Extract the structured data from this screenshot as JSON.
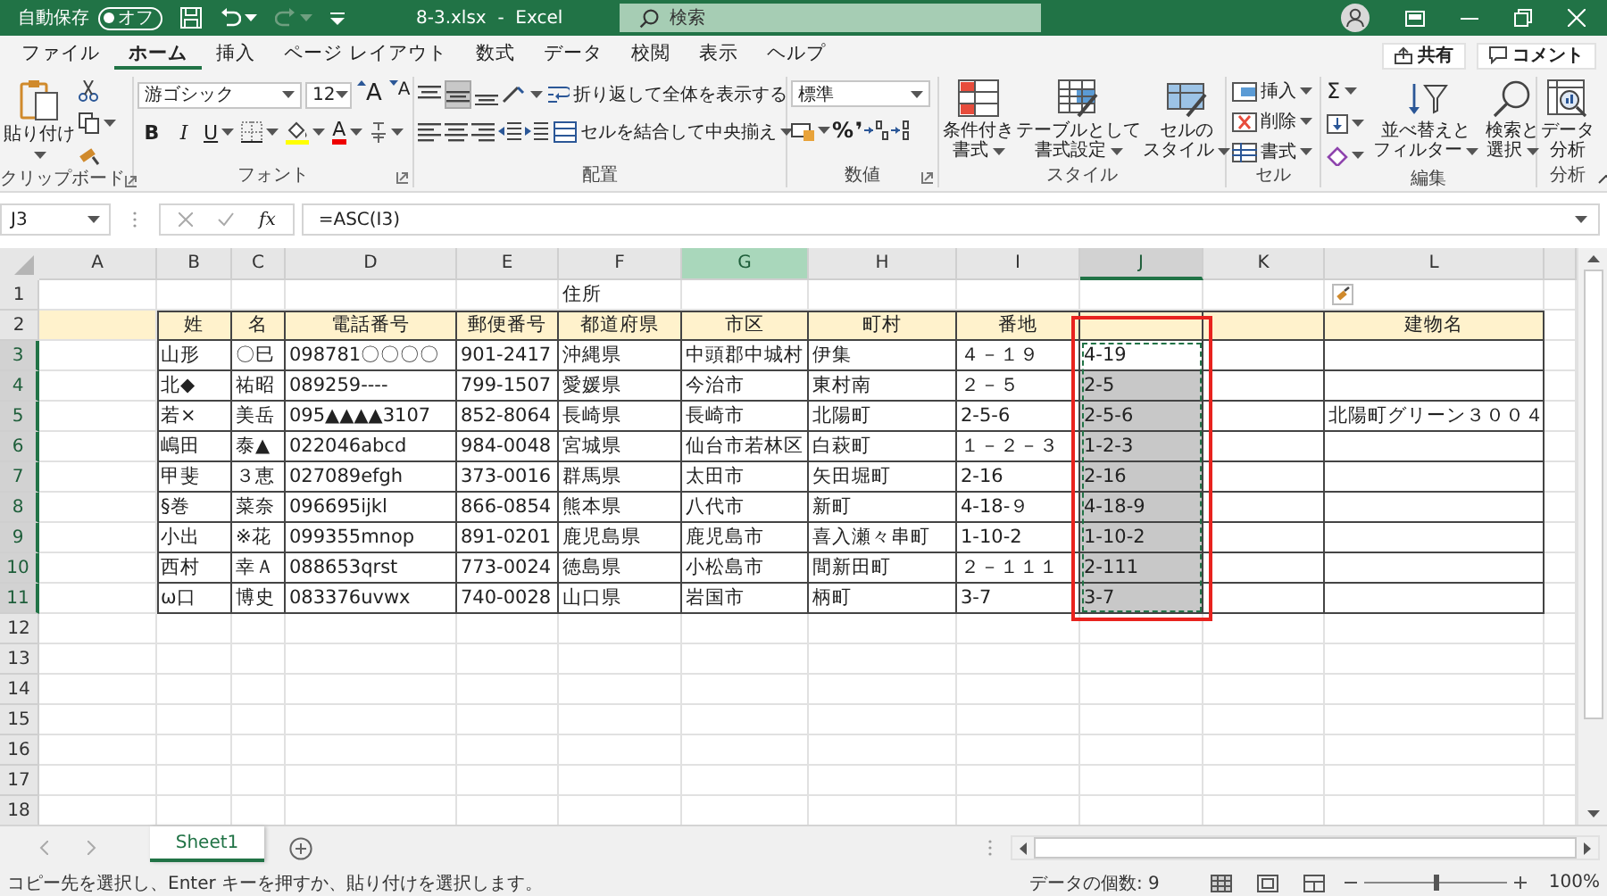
{
  "titlebar": {
    "autosave_label": "自動保存",
    "autosave_toggle": "オフ",
    "autosave_on": false,
    "title": "8-3.xlsx  -  Excel",
    "search_placeholder": "検索"
  },
  "ribbon_tabs": [
    {
      "label": "ファイル",
      "selected": false
    },
    {
      "label": "ホーム",
      "selected": true
    },
    {
      "label": "挿入",
      "selected": false
    },
    {
      "label": "ページ レイアウト",
      "selected": false
    },
    {
      "label": "数式",
      "selected": false
    },
    {
      "label": "データ",
      "selected": false
    },
    {
      "label": "校閲",
      "selected": false
    },
    {
      "label": "表示",
      "selected": false
    },
    {
      "label": "ヘルプ",
      "selected": false
    }
  ],
  "share": "共有",
  "comment": "コメント",
  "ribbon_groups": [
    {
      "kind": "clipboard",
      "label": "クリップボード",
      "launcher": true,
      "paste": "貼り付け"
    },
    {
      "kind": "font",
      "label": "フォント",
      "launcher": true,
      "font": "游ゴシック",
      "size": "12",
      "grow": "A",
      "shrink": "A",
      "bold": "B",
      "italic": "I",
      "underline": "U",
      "font_color": "A"
    },
    {
      "kind": "alignment",
      "label": "配置",
      "launcher": false,
      "vertical_align": [
        {
          "selected": false
        },
        {
          "selected": true
        },
        {
          "selected": false
        }
      ],
      "wrap": "折り返して全体を表示する",
      "merge": "セルを結合して中央揃え"
    },
    {
      "kind": "number",
      "label": "数値",
      "launcher": true,
      "format": "標準",
      "percent": "%",
      "comma": "❜"
    },
    {
      "kind": "styles",
      "label": "スタイル",
      "launcher": false,
      "buttons": [
        [
          "条件付き",
          "書式"
        ],
        [
          "テーブルとして",
          "書式設定"
        ],
        [
          "セルの",
          "スタイル"
        ]
      ]
    },
    {
      "kind": "cells",
      "label": "セル",
      "launcher": false,
      "buttons": [
        "挿入",
        "削除",
        "書式"
      ]
    },
    {
      "kind": "editing",
      "label": "編集",
      "launcher": false,
      "sum": "Σ",
      "buttons": [
        [
          "並べ替えと",
          "フィルター"
        ],
        [
          "検索と",
          "選択"
        ]
      ]
    },
    {
      "kind": "analysis",
      "label": "分析",
      "launcher": false,
      "buttons": [
        [
          "データ",
          "分析"
        ]
      ]
    }
  ],
  "formula_bar": {
    "name_box": "J3",
    "fx": "fx",
    "formula": "=ASC(I3)"
  },
  "columns": [
    {
      "label": "A",
      "selected": false,
      "highlighted": false
    },
    {
      "label": "B",
      "selected": false,
      "highlighted": false
    },
    {
      "label": "C",
      "selected": false,
      "highlighted": false
    },
    {
      "label": "D",
      "selected": false,
      "highlighted": false
    },
    {
      "label": "E",
      "selected": false,
      "highlighted": false
    },
    {
      "label": "F",
      "selected": false,
      "highlighted": false
    },
    {
      "label": "G",
      "selected": false,
      "highlighted": true
    },
    {
      "label": "H",
      "selected": false,
      "highlighted": false
    },
    {
      "label": "I",
      "selected": false,
      "highlighted": false
    },
    {
      "label": "J",
      "selected": true,
      "highlighted": false,
      "active": true,
      "copied": true,
      "framed": true
    },
    {
      "label": "K",
      "selected": false,
      "highlighted": false
    },
    {
      "label": "L",
      "selected": false,
      "highlighted": false,
      "paste_options": true
    }
  ],
  "rows": [
    {
      "header": "1",
      "kind": "plain",
      "selected": false,
      "cells": [
        null,
        null,
        null,
        null,
        null,
        "住所"
      ]
    },
    {
      "header": "2",
      "kind": "header",
      "selected": false,
      "cells": [
        null,
        "姓",
        "名",
        "電話番号",
        "郵便番号",
        "都道府県",
        "市区",
        "町村",
        "番地",
        null,
        null,
        "建物名"
      ]
    },
    {
      "header": "3",
      "kind": "data",
      "selected": true,
      "active": true,
      "cells": [
        null,
        "山形",
        "〇巳",
        "098781〇〇〇〇",
        "901-2417",
        "沖縄県",
        "中頭郡中城村",
        "伊集",
        "４－１９",
        "4-19"
      ]
    },
    {
      "header": "4",
      "kind": "data",
      "selected": true,
      "cells": [
        null,
        "北◆",
        "祐昭",
        "089259----",
        "799-1507",
        "愛媛県",
        "今治市",
        "東村南",
        "２－５",
        "2-5"
      ]
    },
    {
      "header": "5",
      "kind": "data",
      "selected": true,
      "cells": [
        null,
        "若×",
        "美岳",
        "095▲▲▲▲3107",
        "852-8064",
        "長崎県",
        "長崎市",
        "北陽町",
        "2-5-6",
        "2-5-6",
        null,
        "北陽町グリーン３００４"
      ]
    },
    {
      "header": "6",
      "kind": "data",
      "selected": true,
      "cells": [
        null,
        "嶋田",
        "泰▲",
        "022046abcd",
        "984-0048",
        "宮城県",
        "仙台市若林区",
        "白萩町",
        "１－２－３",
        "1-2-3"
      ]
    },
    {
      "header": "7",
      "kind": "data",
      "selected": true,
      "cells": [
        null,
        "甲斐",
        "３恵",
        "027089efgh",
        "373-0016",
        "群馬県",
        "太田市",
        "矢田堀町",
        "2-16",
        "2-16"
      ]
    },
    {
      "header": "8",
      "kind": "data",
      "selected": true,
      "cells": [
        null,
        "§巻",
        "菜奈",
        "096695ijkl",
        "866-0854",
        "熊本県",
        "八代市",
        "新町",
        "4-18-９",
        "4-18-9"
      ]
    },
    {
      "header": "9",
      "kind": "data",
      "selected": true,
      "cells": [
        null,
        "小出",
        "※花",
        "099355mnop",
        "891-0201",
        "鹿児島県",
        "鹿児島市",
        "喜入瀬々串町",
        "1-10-2",
        "1-10-2"
      ]
    },
    {
      "header": "10",
      "kind": "data",
      "selected": true,
      "cells": [
        null,
        "西村",
        "幸Ａ",
        "088653qrst",
        "773-0024",
        "徳島県",
        "小松島市",
        "間新田町",
        "２－１１１",
        "2-111"
      ]
    },
    {
      "header": "11",
      "kind": "data",
      "selected": true,
      "cells": [
        null,
        "ω口",
        "博史",
        "083376uvwx",
        "740-0028",
        "山口県",
        "岩国市",
        "柄町",
        "3-7",
        "3-7"
      ]
    },
    {
      "header": "12",
      "kind": "plain",
      "selected": false
    },
    {
      "header": "13",
      "kind": "plain",
      "selected": false
    },
    {
      "header": "14",
      "kind": "plain",
      "selected": false
    },
    {
      "header": "15",
      "kind": "plain",
      "selected": false
    },
    {
      "header": "16",
      "kind": "plain",
      "selected": false
    },
    {
      "header": "17",
      "kind": "plain",
      "selected": false
    },
    {
      "header": "18",
      "kind": "plain",
      "selected": false
    }
  ],
  "sheet_tabs": [
    {
      "label": "Sheet1",
      "selected": true
    }
  ],
  "status_bar": {
    "message": "コピー先を選択し、Enter キーを押すか、貼り付けを選択します。",
    "count": "データの個数: 9",
    "zoom": "100%",
    "level": 0.5
  }
}
